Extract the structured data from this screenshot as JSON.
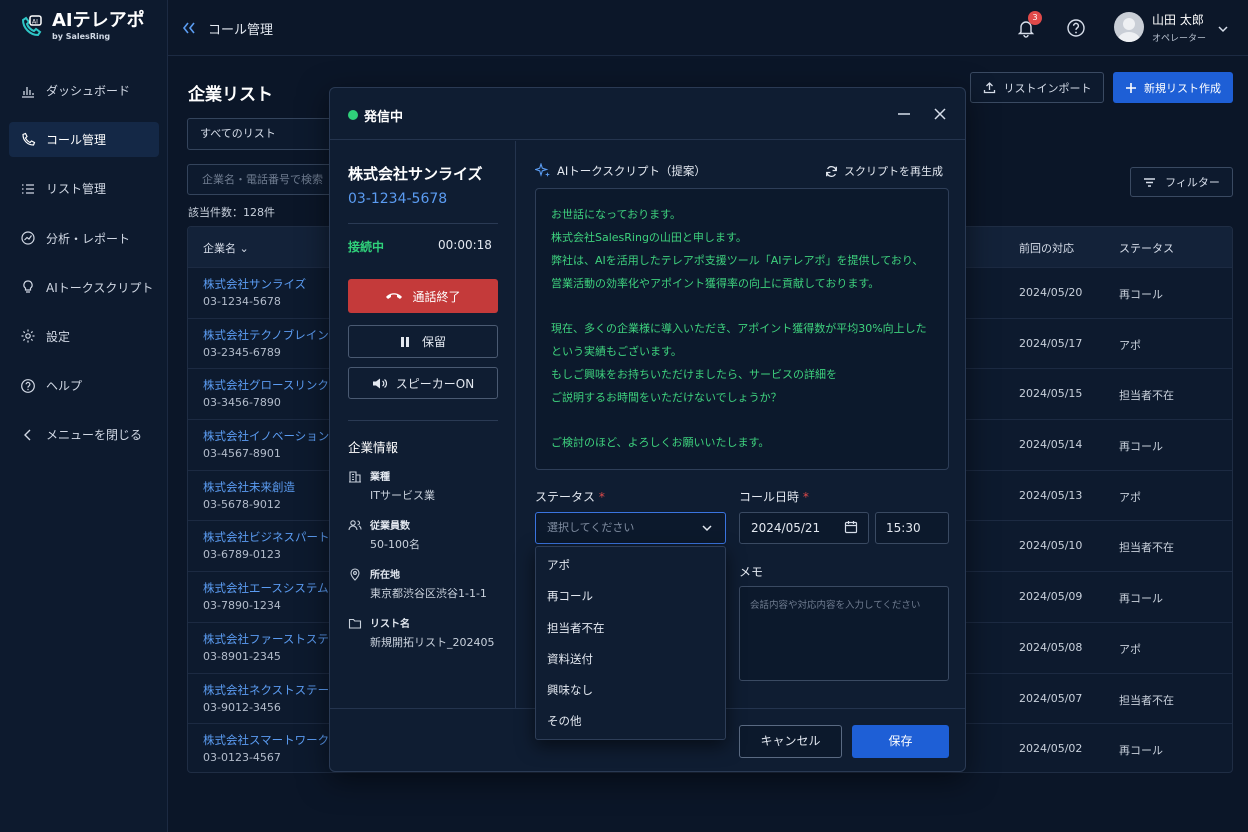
{
  "app": {
    "name": "AIテレアポ",
    "sub": "by SalesRing"
  },
  "colors": {
    "accent": "#1e5fd6",
    "link": "#5b9cf2",
    "success": "#2fd07a",
    "danger": "#c43a3a",
    "script_text": "#3ed27e"
  },
  "sidebar": {
    "items": [
      {
        "label": "ダッシュボード",
        "icon": "bar-chart-icon"
      },
      {
        "label": "コール管理",
        "icon": "phone-icon"
      },
      {
        "label": "リスト管理",
        "icon": "list-icon"
      },
      {
        "label": "分析・レポート",
        "icon": "analytics-icon"
      },
      {
        "label": "AIトークスクリプト",
        "icon": "lightbulb-icon"
      },
      {
        "label": "設定",
        "icon": "gear-icon"
      },
      {
        "label": "ヘルプ",
        "icon": "help-icon"
      },
      {
        "label": "メニューを閉じる",
        "icon": "chevron-left-icon"
      }
    ],
    "active_index": 1
  },
  "topbar": {
    "breadcrumb": "コール管理",
    "notification_count": "3"
  },
  "user": {
    "name": "山田 太郎",
    "role": "オペレーター"
  },
  "page": {
    "title": "企業リスト",
    "import_label": "リストインポート",
    "new_label": "新規リスト作成",
    "list_select": "すべてのリスト",
    "search_placeholder": "企業名・電話番号で検索",
    "count": "該当件数：128件",
    "filter_label": "フィルター"
  },
  "table": {
    "headers": {
      "company": "企業名",
      "last": "前回の対応",
      "status": "ステータス"
    },
    "rows": [
      {
        "name": "株式会社サンライズ",
        "phone": "03-1234-5678",
        "date": "2024/05/20",
        "status": "再コール"
      },
      {
        "name": "株式会社テクノブレイン",
        "phone": "03-2345-6789",
        "date": "2024/05/17",
        "status": "アポ"
      },
      {
        "name": "株式会社グロースリンク",
        "phone": "03-3456-7890",
        "date": "2024/05/15",
        "status": "担当者不在"
      },
      {
        "name": "株式会社イノベーションズ",
        "phone": "03-4567-8901",
        "date": "2024/05/14",
        "status": "再コール"
      },
      {
        "name": "株式会社未来創造",
        "phone": "03-5678-9012",
        "date": "2024/05/13",
        "status": "アポ"
      },
      {
        "name": "株式会社ビジネスパートナー",
        "phone": "03-6789-0123",
        "date": "2024/05/10",
        "status": "担当者不在"
      },
      {
        "name": "株式会社エースシステム",
        "phone": "03-7890-1234",
        "date": "2024/05/09",
        "status": "再コール"
      },
      {
        "name": "株式会社ファーストステップ",
        "phone": "03-8901-2345",
        "date": "2024/05/08",
        "status": "アポ"
      },
      {
        "name": "株式会社ネクストステージ",
        "phone": "03-9012-3456",
        "date": "2024/05/07",
        "status": "担当者不在"
      },
      {
        "name": "株式会社スマートワークス",
        "phone": "03-0123-4567",
        "date": "2024/05/02",
        "status": "再コール"
      }
    ]
  },
  "call": {
    "title": "発信中",
    "company": "株式会社サンライズ",
    "phone": "03-1234-5678",
    "state": "接続中",
    "timer": "00:00:18",
    "end_label": "通話終了",
    "hold_label": "保留",
    "speaker_label": "スピーカーON",
    "info_title": "企業情報",
    "info": [
      {
        "label": "業種",
        "value": "ITサービス業",
        "icon": "building-icon"
      },
      {
        "label": "従業員数",
        "value": "50-100名",
        "icon": "people-icon"
      },
      {
        "label": "所在地",
        "value": "東京都渋谷区渋谷1-1-1",
        "icon": "location-icon"
      },
      {
        "label": "リスト名",
        "value": "新規開拓リスト_202405",
        "icon": "folder-icon"
      }
    ],
    "script_title": "AIトークスクリプト（提案）",
    "regen_label": "スクリプトを再生成",
    "script": {
      "p1": [
        "お世話になっております。",
        "株式会社SalesRingの山田と申します。",
        "弊社は、AIを活用したテレアポ支援ツール「AIテレアポ」を提供しており、",
        "営業活動の効率化やアポイント獲得率の向上に貢献しております。"
      ],
      "p2": [
        "現在、多くの企業様に導入いただき、アポイント獲得数が平均30%向上した",
        "という実績もございます。",
        "もしご興味をお持ちいただけましたら、サービスの詳細を",
        "ご説明するお時間をいただけないでしょうか？"
      ],
      "p3": [
        "ご検討のほど、よろしくお願いいたします。"
      ]
    },
    "status_label": "ステータス",
    "status_placeholder": "選択してください",
    "status_options": [
      "アポ",
      "再コール",
      "担当者不在",
      "資料送付",
      "興味なし",
      "その他"
    ],
    "datetime_label": "コール日時",
    "date": "2024/05/21",
    "time": "15:30",
    "memo_label": "メモ",
    "memo_placeholder": "会話内容や対応内容を入力してください",
    "cancel_label": "キャンセル",
    "save_label": "保存"
  }
}
